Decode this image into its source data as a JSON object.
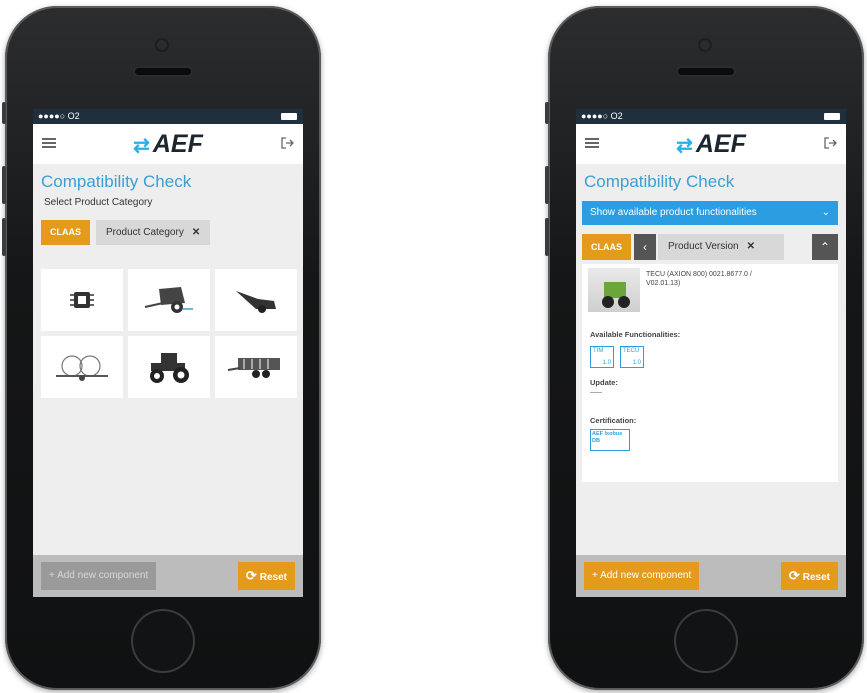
{
  "left_phone": {
    "status": {
      "carrier": "●●●●○ O2"
    },
    "appbar": {
      "logo": "AEF",
      "logo_mark": "⇄"
    },
    "title": "Compatibility Check",
    "subtitle": "Select Product Category",
    "chips": {
      "brand": "CLAAS",
      "category": "Product Category",
      "remove": "✕"
    },
    "categories": [
      {
        "icon": "ecu-chip-icon"
      },
      {
        "icon": "baler-icon"
      },
      {
        "icon": "sprayer-icon"
      },
      {
        "icon": "hay-rake-icon"
      },
      {
        "icon": "tractor-icon"
      },
      {
        "icon": "trailer-icon"
      }
    ],
    "bottom": {
      "add_label": "+ Add new component",
      "reset_label": "Reset",
      "reset_icon": "⟳"
    }
  },
  "right_phone": {
    "status": {
      "carrier": "●●●●○ O2"
    },
    "appbar": {
      "logo": "AEF",
      "logo_mark": "⇄"
    },
    "title": "Compatibility Check",
    "dropdown": {
      "label": "Show available product functionalities",
      "chevron": "⌄"
    },
    "chips": {
      "brand": "CLAAS",
      "back": "‹",
      "version": "Product Version",
      "remove": "✕",
      "collapse": "⌃"
    },
    "product": {
      "line1": "TECU (AXION 800) 0021.8677.0 /",
      "line2": "V02.01.13)"
    },
    "functionalities": {
      "label": "Available Functionalities:",
      "items": [
        {
          "name": "TIM",
          "version": "1.0"
        },
        {
          "name": "TECU",
          "version": "1.0"
        }
      ]
    },
    "update": {
      "label": "Update:"
    },
    "certification": {
      "label": "Certification:",
      "badge": "AEF Isobus DB"
    },
    "bottom": {
      "add_label": "+ Add new component",
      "reset_label": "Reset",
      "reset_icon": "⟳"
    }
  },
  "colors": {
    "accent_orange": "#e49b1c",
    "accent_blue": "#2a9ee0",
    "title_blue": "#3a9fd6",
    "statusbar": "#1f2f3d"
  }
}
